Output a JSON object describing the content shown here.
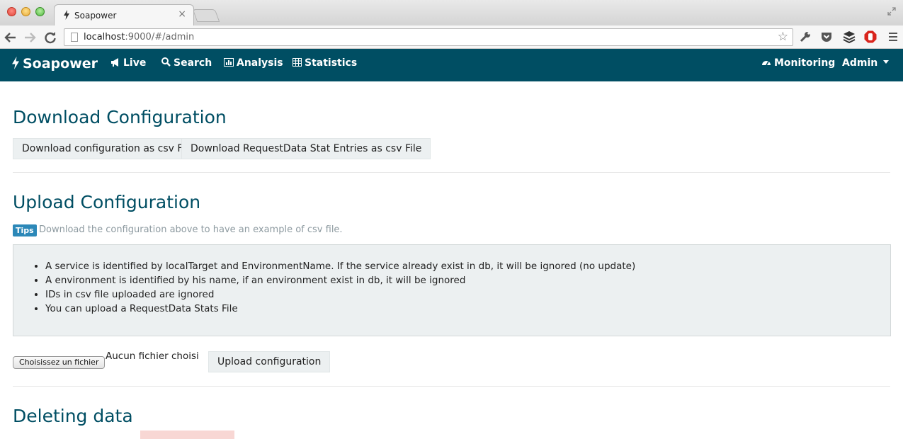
{
  "browser": {
    "tab_title": "Soapower",
    "tab_close": "×",
    "url_host": "localhost",
    "url_rest": ":9000/#/admin"
  },
  "navbar": {
    "brand": "Soapower",
    "links": {
      "live": "Live",
      "search": "Search",
      "analysis": "Analysis",
      "statistics": "Statistics",
      "monitoring": "Monitoring",
      "admin": "Admin"
    },
    "color": "#004e63"
  },
  "download": {
    "heading": "Download Configuration",
    "btn_config": "Download configuration as csv File",
    "btn_stats": "Download RequestData Stat Entries as csv File"
  },
  "upload": {
    "heading": "Upload Configuration",
    "tips_badge": "Tips",
    "tips_text": "Download the configuration above to have an example of csv file.",
    "notes": [
      "A service is identified by localTarget and EnvironmentName. If the service already exist in db, it will be ignored (no update)",
      "A environment is identified by his name, if an environment exist in db, it will be ignored",
      "IDs in csv file uploaded are ignored",
      "You can upload a RequestData Stats File"
    ],
    "file_button": "Choisissez un fichier",
    "file_status": "Aucun fichier choisi",
    "submit": "Upload configuration"
  },
  "deleting": {
    "heading": "Deleting data"
  }
}
